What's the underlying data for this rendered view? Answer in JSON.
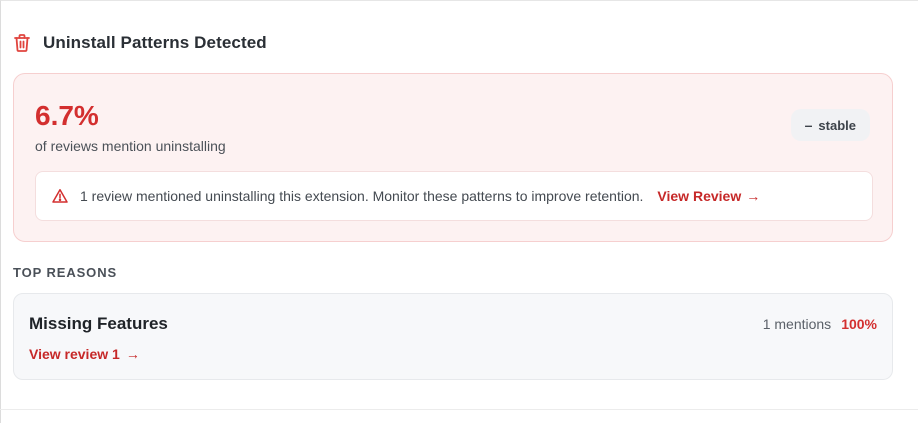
{
  "header": {
    "title": "Uninstall Patterns Detected",
    "icon": "trash-icon"
  },
  "stat": {
    "value": "6.7%",
    "caption": "of reviews mention uninstalling",
    "trend_label": "stable",
    "trend_icon": "–"
  },
  "alert": {
    "message": "1 review mentioned uninstalling this extension. Monitor these patterns to improve retention.",
    "link_label": "View Review",
    "link_arrow": "→"
  },
  "reasons": {
    "section_label": "TOP REASONS",
    "items": [
      {
        "title": "Missing Features",
        "link_label": "View review 1",
        "link_arrow": "→",
        "mentions": "1 mentions",
        "percent": "100%"
      }
    ]
  },
  "colors": {
    "accent_red": "#d32f2f",
    "card_bg": "#fdf2f2",
    "card_border": "#f6cfcf"
  }
}
